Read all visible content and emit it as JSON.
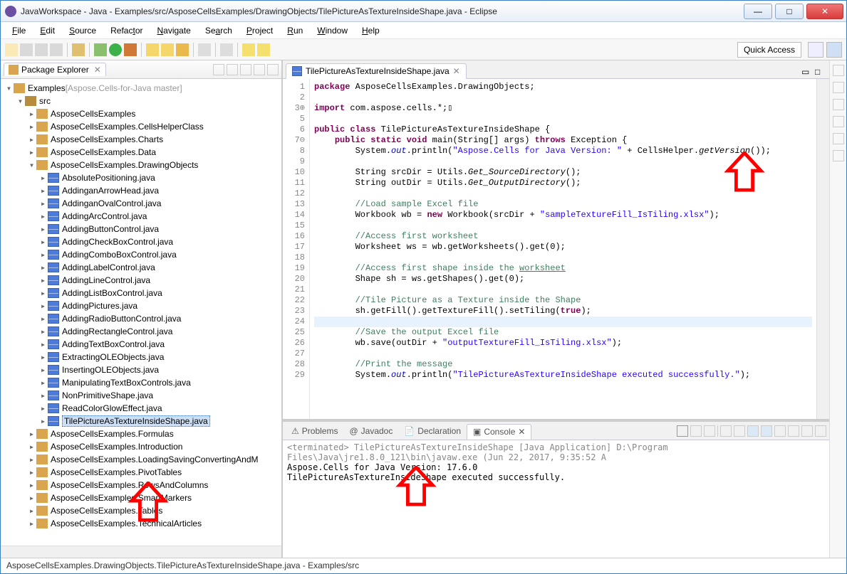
{
  "window": {
    "title": "JavaWorkspace - Java - Examples/src/AsposeCellsExamples/DrawingObjects/TilePictureAsTextureInsideShape.java - Eclipse"
  },
  "menu": [
    "File",
    "Edit",
    "Source",
    "Refactor",
    "Navigate",
    "Search",
    "Project",
    "Run",
    "Window",
    "Help"
  ],
  "quick_access": "Quick Access",
  "package_explorer": {
    "title": "Package Explorer",
    "project": "Examples",
    "repo": "[Aspose.Cells-for-Java master]",
    "src": "src",
    "packages_top": [
      "AsposeCellsExamples",
      "AsposeCellsExamples.CellsHelperClass",
      "AsposeCellsExamples.Charts",
      "AsposeCellsExamples.Data"
    ],
    "package_open": "AsposeCellsExamples.DrawingObjects",
    "files": [
      "AbsolutePositioning.java",
      "AddinganArrowHead.java",
      "AddinganOvalControl.java",
      "AddingArcControl.java",
      "AddingButtonControl.java",
      "AddingCheckBoxControl.java",
      "AddingComboBoxControl.java",
      "AddingLabelControl.java",
      "AddingLineControl.java",
      "AddingListBoxControl.java",
      "AddingPictures.java",
      "AddingRadioButtonControl.java",
      "AddingRectangleControl.java",
      "AddingTextBoxControl.java",
      "ExtractingOLEObjects.java",
      "InsertingOLEObjects.java",
      "ManipulatingTextBoxControls.java",
      "NonPrimitiveShape.java",
      "ReadColorGlowEffect.java",
      "TilePictureAsTextureInsideShape.java"
    ],
    "packages_bottom": [
      "AsposeCellsExamples.Formulas",
      "AsposeCellsExamples.Introduction",
      "AsposeCellsExamples.LoadingSavingConvertingAndM",
      "AsposeCellsExamples.PivotTables",
      "AsposeCellsExamples.RowsAndColumns",
      "AsposeCellsExamples.SmartMarkers",
      "AsposeCellsExamples.Tables",
      "AsposeCellsExamples.TechnicalArticles"
    ],
    "selected_file": "TilePictureAsTextureInsideShape.java"
  },
  "editor": {
    "tab": "TilePictureAsTextureInsideShape.java",
    "lines": [
      {
        "n": 1,
        "html": "<span class='kw'>package</span> AsposeCellsExamples.DrawingObjects;"
      },
      {
        "n": 2,
        "html": ""
      },
      {
        "n": "3⊕",
        "html": "<span class='kw'>import</span> com.aspose.cells.*;▯"
      },
      {
        "n": 5,
        "html": ""
      },
      {
        "n": 6,
        "html": "<span class='kw'>public class</span> TilePictureAsTextureInsideShape {"
      },
      {
        "n": "7⊖",
        "html": "    <span class='kw'>public static void</span> main(String[] args) <span class='kw'>throws</span> Exception {"
      },
      {
        "n": 8,
        "html": "        System.<span class='fld'>out</span>.println(<span class='str'>\"Aspose.Cells for Java Version: \"</span> + CellsHelper.<span class='mtd'>getVersion</span>());"
      },
      {
        "n": 9,
        "html": ""
      },
      {
        "n": 10,
        "html": "        String srcDir = Utils.<span class='mtd'>Get_SourceDirectory</span>();"
      },
      {
        "n": 11,
        "html": "        String outDir = Utils.<span class='mtd'>Get_OutputDirectory</span>();"
      },
      {
        "n": 12,
        "html": ""
      },
      {
        "n": 13,
        "html": "        <span class='cm'>//Load sample Excel file</span>"
      },
      {
        "n": 14,
        "html": "        Workbook wb = <span class='kw'>new</span> Workbook(srcDir + <span class='str'>\"sampleTextureFill_IsTiling.xlsx\"</span>);"
      },
      {
        "n": 15,
        "html": ""
      },
      {
        "n": 16,
        "html": "        <span class='cm'>//Access first worksheet</span>"
      },
      {
        "n": 17,
        "html": "        Worksheet ws = wb.getWorksheets().get(0);"
      },
      {
        "n": 18,
        "html": ""
      },
      {
        "n": 19,
        "html": "        <span class='cm'>//Access first shape inside the <u>worksheet</u></span>"
      },
      {
        "n": 20,
        "html": "        Shape sh = ws.getShapes().get(0);"
      },
      {
        "n": 21,
        "html": ""
      },
      {
        "n": 22,
        "html": "        <span class='cm'>//Tile Picture as a Texture inside the Shape</span>"
      },
      {
        "n": 23,
        "html": "        sh.getFill().getTextureFill().setTiling(<span class='kw'>true</span>);"
      },
      {
        "n": 24,
        "html": "",
        "hl": true
      },
      {
        "n": 25,
        "html": "        <span class='cm'>//Save the output Excel file</span>"
      },
      {
        "n": 26,
        "html": "        wb.save(outDir + <span class='str'>\"outputTextureFill_IsTiling.xlsx\"</span>);"
      },
      {
        "n": 27,
        "html": ""
      },
      {
        "n": 28,
        "html": "        <span class='cm'>//Print the message</span>"
      },
      {
        "n": 29,
        "html": "        System.<span class='fld'>out</span>.println(<span class='str'>\"TilePictureAsTextureInsideShape executed successfully.\"</span>);"
      }
    ]
  },
  "bottom_tabs": [
    "Problems",
    "Javadoc",
    "Declaration",
    "Console"
  ],
  "console": {
    "header": "<terminated> TilePictureAsTextureInsideShape [Java Application] D:\\Program Files\\Java\\jre1.8.0_121\\bin\\javaw.exe (Jun 22, 2017, 9:35:52 A",
    "lines": [
      "Aspose.Cells for Java Version: 17.6.0",
      "TilePictureAsTextureInsideShape executed successfully."
    ]
  },
  "status": "AsposeCellsExamples.DrawingObjects.TilePictureAsTextureInsideShape.java - Examples/src"
}
